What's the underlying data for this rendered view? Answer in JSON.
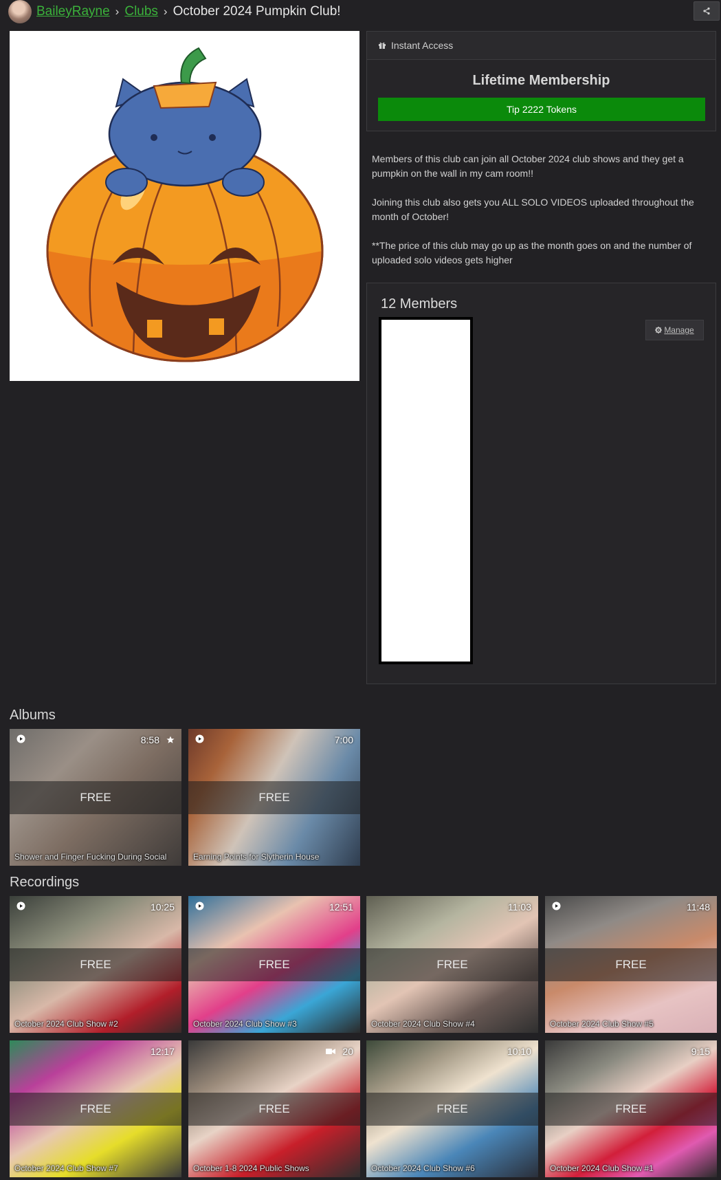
{
  "breadcrumb": {
    "user": "BaileyRayne",
    "sep1": "›",
    "clubs": "Clubs",
    "sep2": "›",
    "current": "October 2024 Pumpkin Club!"
  },
  "access": {
    "header_label": "Instant Access",
    "title": "Lifetime Membership",
    "tip_label": "Tip 2222 Tokens"
  },
  "description": [
    "Members of this club can join all October 2024 club shows and they get a pumpkin on the wall in my cam room!!",
    "Joining this club also gets you ALL SOLO VIDEOS uploaded throughout the month of October!",
    "**The price of this club may go up as the month goes on and the number of uploaded solo videos gets higher"
  ],
  "members": {
    "title": "12 Members",
    "manage_label": "Manage"
  },
  "albums": {
    "title": "Albums",
    "items": [
      {
        "duration": "8:58",
        "badge": "FREE",
        "caption": "Shower and Finger Fucking During Social"
      },
      {
        "duration": "7:00",
        "badge": "FREE",
        "caption": "Earning Points for Slytherin House"
      }
    ]
  },
  "recordings": {
    "title": "Recordings",
    "items": [
      {
        "duration": "10:25",
        "badge": "FREE",
        "caption": "October 2024 Club Show #2"
      },
      {
        "duration": "12:51",
        "badge": "FREE",
        "caption": "October 2024 Club Show #3"
      },
      {
        "duration": "11:03",
        "badge": "FREE",
        "caption": "October 2024 Club Show #4"
      },
      {
        "duration": "11:48",
        "badge": "FREE",
        "caption": "October 2024 Club Show #5"
      },
      {
        "duration": "12:17",
        "badge": "FREE",
        "caption": "October 2024 Club Show #7"
      },
      {
        "duration": "20",
        "badge": "FREE",
        "caption": "October 1-8 2024 Public Shows"
      },
      {
        "duration": "10:10",
        "badge": "FREE",
        "caption": "October 2024 Club Show #6"
      },
      {
        "duration": "9:15",
        "badge": "FREE",
        "caption": "October 2024 Club Show #1"
      }
    ]
  },
  "colors": {
    "background": "#222124",
    "link": "#3bb23b",
    "tip_button": "#0b8a0b"
  }
}
